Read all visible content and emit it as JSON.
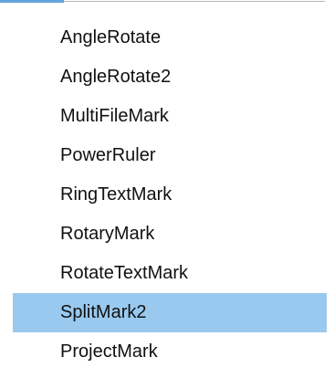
{
  "menu": {
    "items": [
      {
        "label": "AngleRotate"
      },
      {
        "label": "AngleRotate2"
      },
      {
        "label": "MultiFileMark"
      },
      {
        "label": "PowerRuler"
      },
      {
        "label": "RingTextMark"
      },
      {
        "label": "RotaryMark"
      },
      {
        "label": "RotateTextMark"
      },
      {
        "label": "SplitMark2"
      },
      {
        "label": "ProjectMark"
      }
    ],
    "selected_label": "SplitMark2",
    "selected_color": "#99c9ef",
    "accent_color": "#66a3dc"
  }
}
